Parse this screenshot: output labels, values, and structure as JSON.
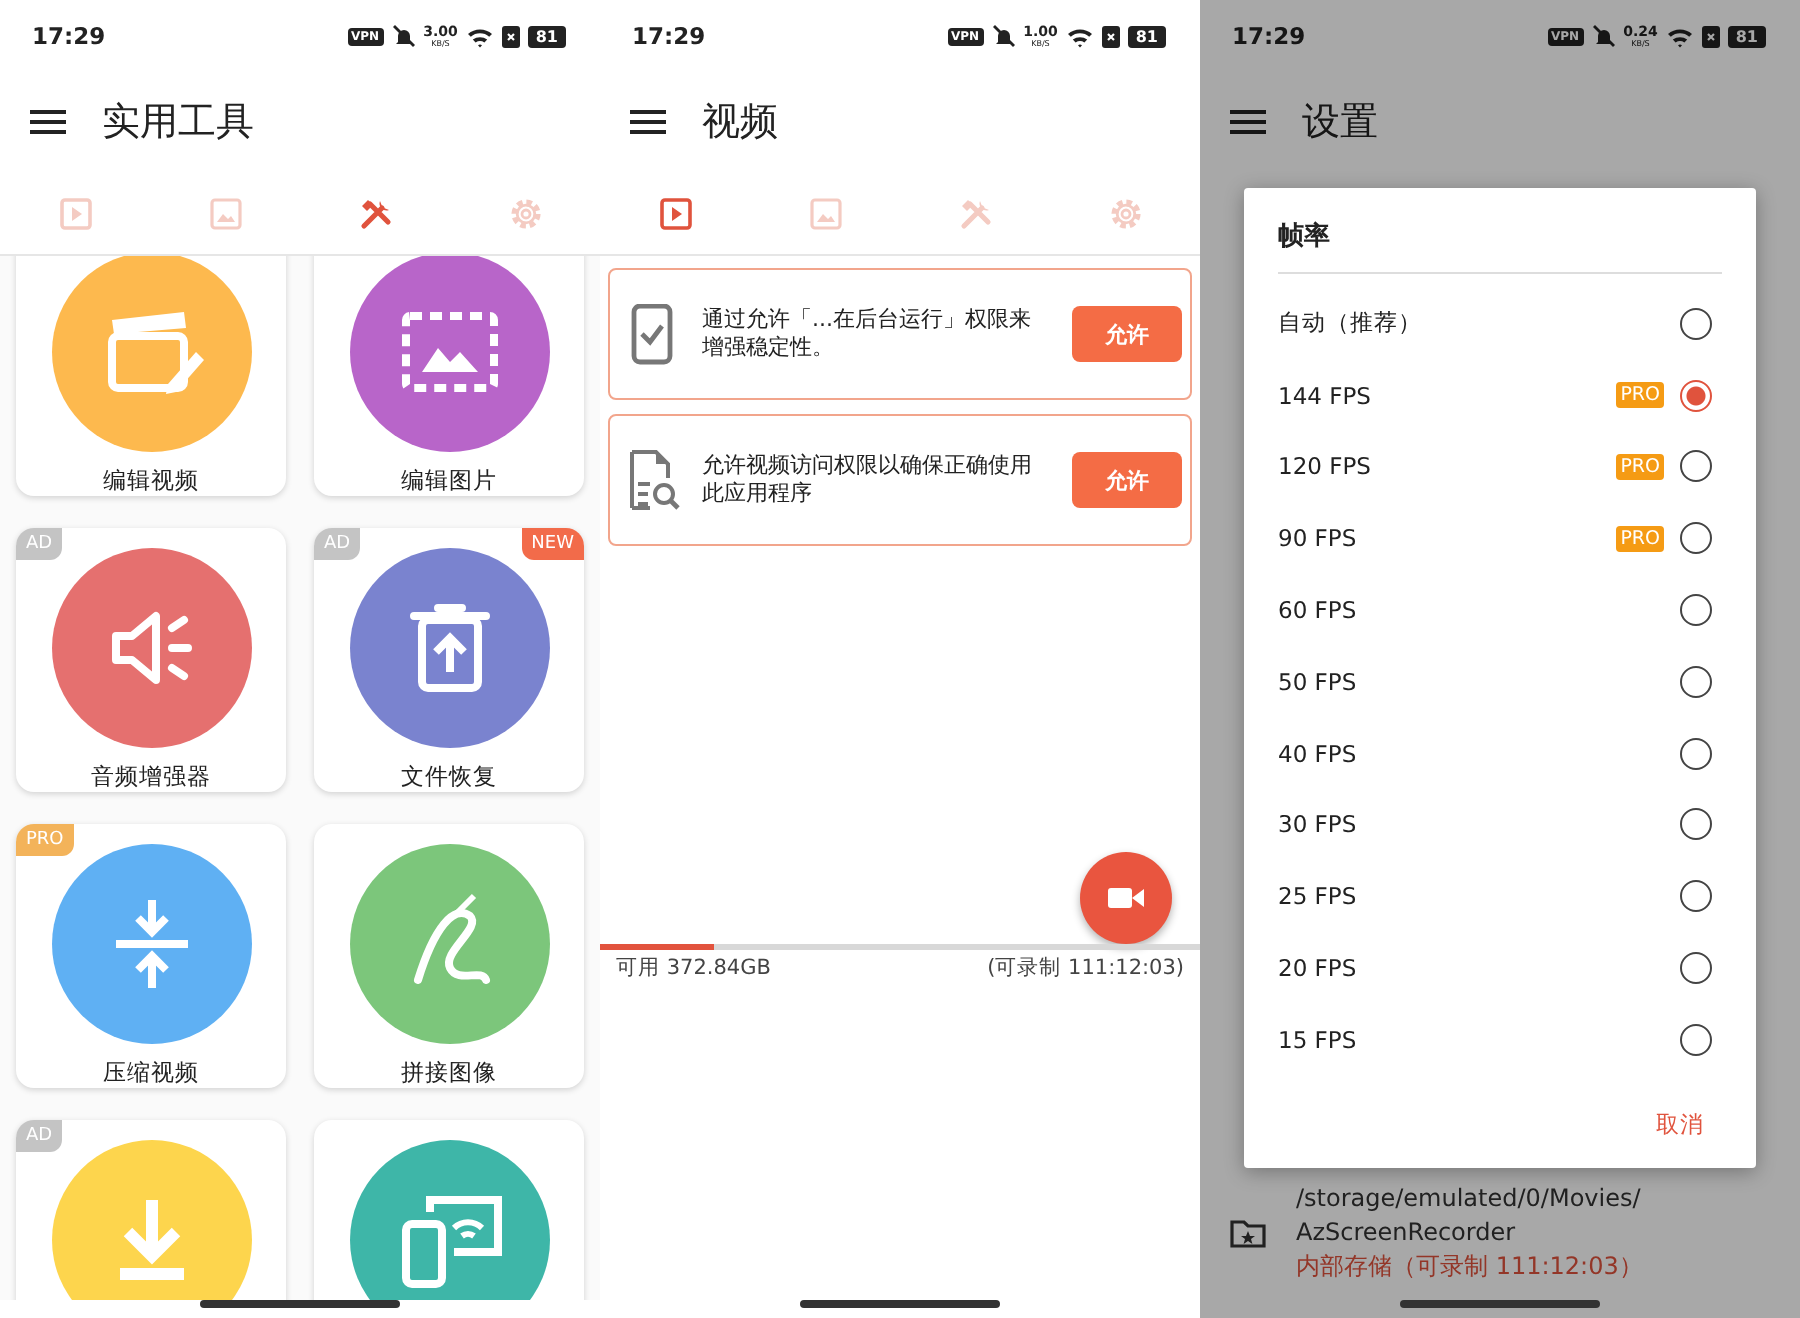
{
  "tools_screen": {
    "status_bar": {
      "time": "17:29",
      "vpn": "VPN",
      "speed_value": "3.00",
      "speed_unit": "KB/S",
      "battery": "81"
    },
    "app_bar": {
      "title": "实用工具"
    },
    "tabs": [
      {
        "kind": "video",
        "selected": false
      },
      {
        "kind": "image",
        "selected": false
      },
      {
        "kind": "tools",
        "selected": true
      },
      {
        "kind": "settings",
        "selected": false
      }
    ],
    "tools": [
      {
        "label": "编辑视频",
        "color": "#fdb94e"
      },
      {
        "label": "编辑图片",
        "color": "#b865c9"
      },
      {
        "label": "音频增强器",
        "color": "#e5706f",
        "badges": [
          {
            "kind": "ad",
            "text": "AD"
          }
        ]
      },
      {
        "label": "文件恢复",
        "color": "#7a83cf",
        "badges": [
          {
            "kind": "ad",
            "text": "AD"
          },
          {
            "kind": "new",
            "text": "NEW"
          }
        ]
      },
      {
        "label": "压缩视频",
        "color": "#5fb0f3",
        "badges": [
          {
            "kind": "pro",
            "text": "PRO"
          }
        ]
      },
      {
        "label": "拼接图像",
        "color": "#7cc67b"
      },
      {
        "color": "#fdd54d",
        "badges": [
          {
            "kind": "ad",
            "text": "AD"
          }
        ]
      },
      {
        "color": "#3eb6a8"
      }
    ]
  },
  "video_screen": {
    "status_bar": {
      "time": "17:29",
      "vpn": "VPN",
      "speed_value": "1.00",
      "speed_unit": "KB/S",
      "battery": "81"
    },
    "app_bar": {
      "title": "视频"
    },
    "tabs": [
      {
        "kind": "video",
        "selected": true
      },
      {
        "kind": "image",
        "selected": false
      },
      {
        "kind": "tools",
        "selected": false
      },
      {
        "kind": "settings",
        "selected": false
      }
    ],
    "permission_cards": [
      {
        "text": "通过允许「...在后台运行」权限来增强稳定性。",
        "button": "允许"
      },
      {
        "text": "允许视频访问权限以确保正确使用此应用程序",
        "button": "允许"
      }
    ],
    "storage": {
      "level": 0.19,
      "free": "可用 372.84GB",
      "record_time": "(可录制 111:12:03)"
    }
  },
  "settings_screen": {
    "status_bar": {
      "time": "17:29",
      "vpn": "VPN",
      "speed_value": "0.24",
      "speed_unit": "KB/S",
      "battery": "81"
    },
    "app_bar": {
      "title": "设置"
    },
    "save_location": {
      "path": "/storage/emulated/0/Movies/\nAzScreenRecorder",
      "storage": "内部存储（可录制 111:12:03）"
    },
    "dialog": {
      "title": "帧率",
      "options": [
        {
          "label": "自动（推荐）",
          "selected": false
        },
        {
          "label": "144 FPS",
          "badge": "PRO",
          "selected": true
        },
        {
          "label": "120 FPS",
          "badge": "PRO",
          "selected": false
        },
        {
          "label": "90 FPS",
          "badge": "PRO",
          "selected": false
        },
        {
          "label": "60 FPS",
          "selected": false
        },
        {
          "label": "50 FPS",
          "selected": false
        },
        {
          "label": "40 FPS",
          "selected": false
        },
        {
          "label": "30 FPS",
          "selected": false
        },
        {
          "label": "25 FPS",
          "selected": false
        },
        {
          "label": "20 FPS",
          "selected": false
        },
        {
          "label": "15 FPS",
          "selected": false
        }
      ],
      "cancel": "取消"
    }
  }
}
